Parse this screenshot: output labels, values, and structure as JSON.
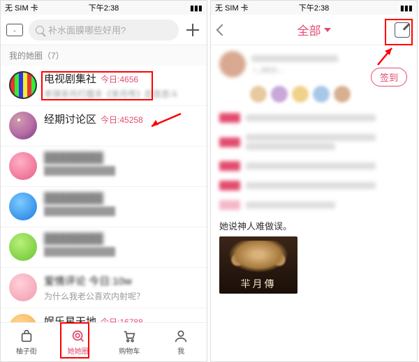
{
  "status": {
    "carrier": "无 SIM 卡",
    "wifi_icon": "wifi",
    "time": "下午2:38",
    "battery_icon": "battery"
  },
  "left": {
    "search_placeholder": "补水面膜哪些好用?",
    "section_header": "我的她圈（7）",
    "rows": [
      {
        "title": "电视剧集社",
        "today_label": "今日:",
        "today_count": "4656",
        "sub": "芈琪非月打擂丰《芈月传》后宫恶斗",
        "avatar": "av-tv",
        "blurred": false
      },
      {
        "title": "经期讨论区",
        "today_label": "今日:",
        "today_count": "45258",
        "sub": "",
        "avatar": "av-ball",
        "blurred": false
      },
      {
        "title": "",
        "today_label": "",
        "today_count": "",
        "sub": "",
        "avatar": "av-pink1",
        "blurred": true
      },
      {
        "title": "",
        "today_label": "",
        "today_count": "",
        "sub": "",
        "avatar": "av-blue",
        "blurred": true
      },
      {
        "title": "",
        "today_label": "",
        "today_count": "",
        "sub": "",
        "avatar": "av-green",
        "blurred": true
      },
      {
        "title": "爱情评论 今日:10w",
        "today_label": "",
        "today_count": "",
        "sub": "为什么我老公喜欢内射呢？",
        "avatar": "av-pink2",
        "blurred": false
      },
      {
        "title": "娱乐星天地",
        "today_label": "今日:",
        "today_count": "16788",
        "sub": "",
        "avatar": "av-orange",
        "blurred": false
      }
    ],
    "tabs": [
      {
        "label": "柚子街",
        "icon": "bag"
      },
      {
        "label": "她她圈",
        "icon": "swirl",
        "active": true
      },
      {
        "label": "购物车",
        "icon": "cart"
      },
      {
        "label": "我",
        "icon": "user"
      }
    ]
  },
  "right": {
    "title": "全部",
    "signin": "签到",
    "nickname_fragment": "♀,,00小...",
    "clear_caption": "她说神人难做误。",
    "poster_title": "羋月傳"
  }
}
